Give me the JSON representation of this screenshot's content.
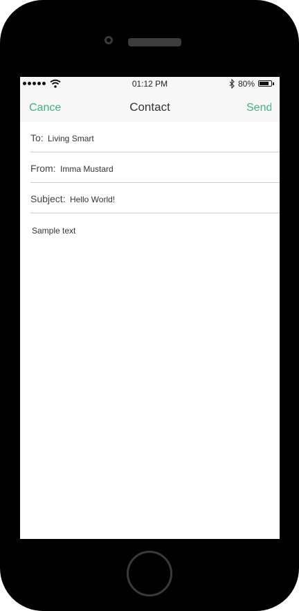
{
  "status": {
    "time": "01:12 PM",
    "battery_percent": "80%",
    "battery_level": 0.8
  },
  "nav": {
    "left_label": "Cance",
    "title": "Contact",
    "right_label": "Send"
  },
  "form": {
    "to_label": "To:",
    "to_value": "Living Smart",
    "from_label": "From:",
    "from_value": "Imma Mustard",
    "subject_label": "Subject:",
    "subject_value": "Hello World!",
    "body": "Sample text"
  },
  "colors": {
    "accent": "#3fb37f"
  }
}
